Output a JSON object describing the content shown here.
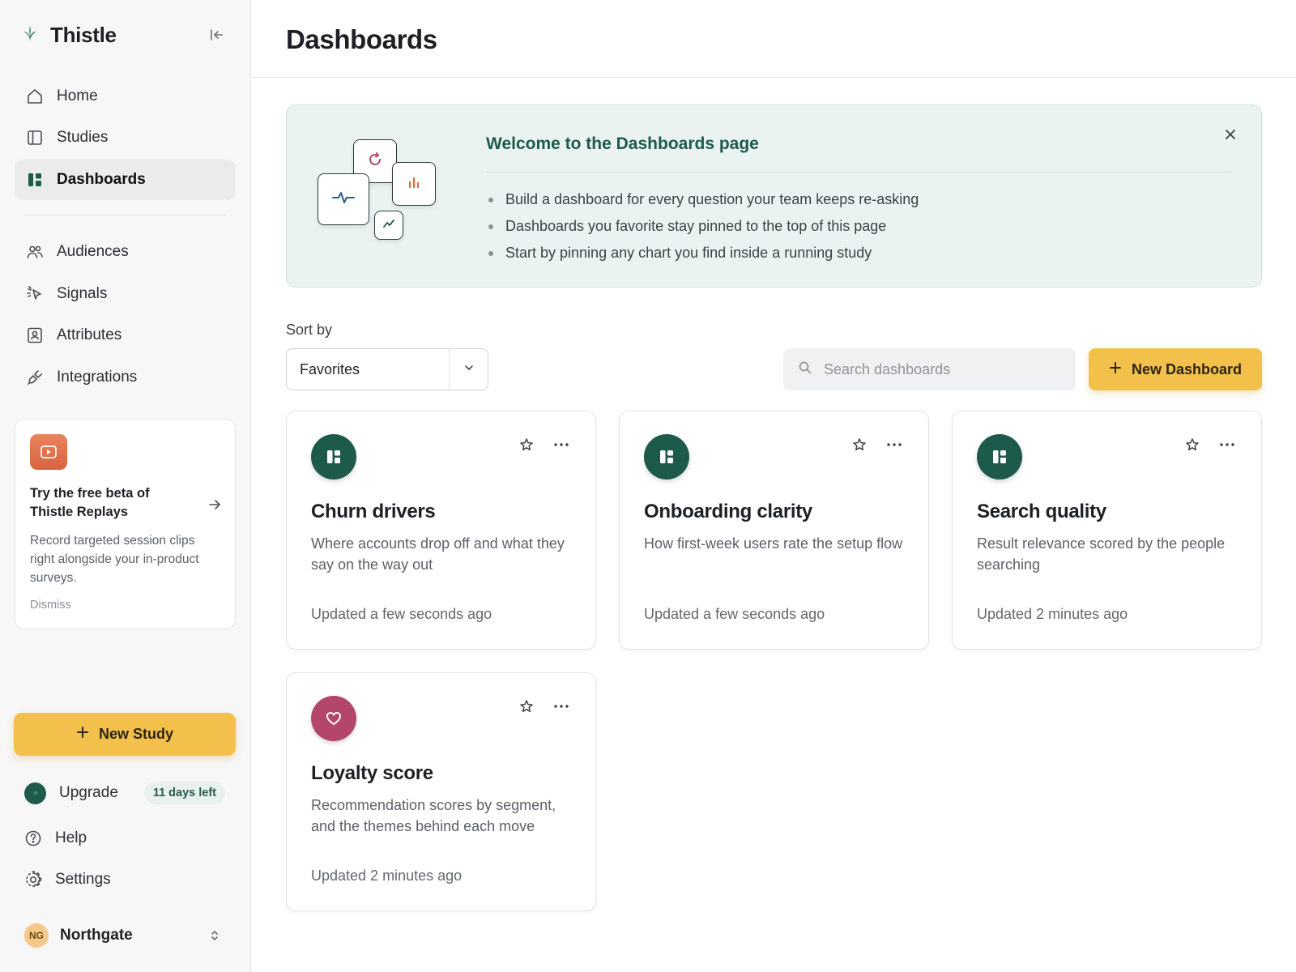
{
  "app": {
    "name": "Thistle"
  },
  "sidebar": {
    "nav_primary": [
      {
        "label": "Home",
        "icon": "home-icon"
      },
      {
        "label": "Studies",
        "icon": "studies-icon"
      },
      {
        "label": "Dashboards",
        "icon": "dashboards-icon",
        "active": true
      }
    ],
    "nav_secondary": [
      {
        "label": "Audiences",
        "icon": "audiences-icon"
      },
      {
        "label": "Signals",
        "icon": "signals-icon"
      },
      {
        "label": "Attributes",
        "icon": "attributes-icon"
      },
      {
        "label": "Integrations",
        "icon": "integrations-icon"
      }
    ],
    "promo": {
      "title": "Try the free beta of Thistle Replays",
      "body": "Record targeted session clips right alongside your in-product surveys.",
      "dismiss": "Dismiss"
    },
    "new_study_label": "New Study",
    "upgrade": {
      "label": "Upgrade",
      "badge": "11 days left"
    },
    "help_label": "Help",
    "settings_label": "Settings",
    "workspace": {
      "initials": "NG",
      "name": "Northgate"
    }
  },
  "main": {
    "title": "Dashboards",
    "welcome": {
      "title": "Welcome to the Dashboards page",
      "bullets": [
        "Build a dashboard for every question your team keeps re-asking",
        "Dashboards you favorite stay pinned to the top of this page",
        "Start by pinning any chart you find inside a running study"
      ]
    },
    "sort": {
      "label": "Sort by",
      "value": "Favorites"
    },
    "search": {
      "placeholder": "Search dashboards",
      "value": ""
    },
    "new_dashboard_label": "New Dashboard",
    "cards": [
      {
        "title": "Churn drivers",
        "description": "Where accounts drop off and what they say on the way out",
        "updated": "Updated a few seconds ago",
        "icon": "dashboard-icon"
      },
      {
        "title": "Onboarding clarity",
        "description": "How first-week users rate the setup flow",
        "updated": "Updated a few seconds ago",
        "icon": "dashboard-icon"
      },
      {
        "title": "Search quality",
        "description": "Result relevance scored by the people searching",
        "updated": "Updated 2 minutes ago",
        "icon": "dashboard-icon"
      },
      {
        "title": "Loyalty score",
        "description": "Recommendation scores by segment, and the themes behind each move",
        "updated": "Updated 2 minutes ago",
        "icon": "heart-icon"
      }
    ]
  },
  "colors": {
    "accent_green": "#1e5a4c",
    "accent_yellow": "#f3c14b",
    "accent_rose": "#b4466a",
    "welcome_bg": "#eaf3f1"
  }
}
